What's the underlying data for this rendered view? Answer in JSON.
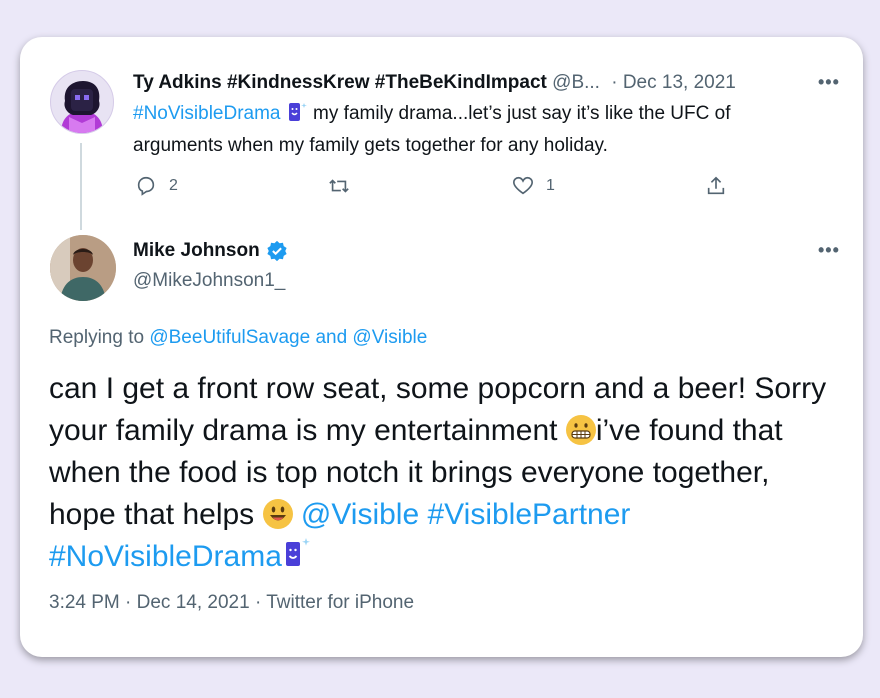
{
  "tweet1": {
    "author_name": "Ty Adkins #KindnessKrew #TheBeKindImpact",
    "handle": "@B...",
    "date": "· Dec 13, 2021",
    "hashtag": "#NoVisibleDrama",
    "text": " my family drama...let’s just say it’s like the UFC of arguments when my family gets together for any holiday.",
    "more": "•••",
    "reply_count": "2",
    "like_count": "1"
  },
  "tweet2": {
    "author_name": "Mike Johnson",
    "handle": "@MikeJohnson1_",
    "more": "•••",
    "replying_prefix": "Replying to ",
    "replying_users": "@BeeUtifulSavage and @Visible",
    "text_part1": "can I get a front row seat, some popcorn and a beer! Sorry your family drama is my entertainment ",
    "text_part2": "i’ve found that when the food is top notch it brings everyone together, hope that helps ",
    "mention": "@Visible",
    "hashtags": "#VisiblePartner #NoVisibleDrama",
    "meta": "3:24 PM · Dec 14, 2021 · Twitter for iPhone"
  },
  "colors": {
    "background": "#ebe8f8",
    "link": "#1d9bf0",
    "verified": "#1d9bf0",
    "secondary_text": "#536471"
  },
  "icons": [
    "reply-icon",
    "retweet-icon",
    "like-icon",
    "share-icon",
    "verified-badge-icon",
    "visible-phone-icon",
    "grimacing-emoji-icon",
    "smiley-emoji-icon",
    "more-options-icon"
  ]
}
